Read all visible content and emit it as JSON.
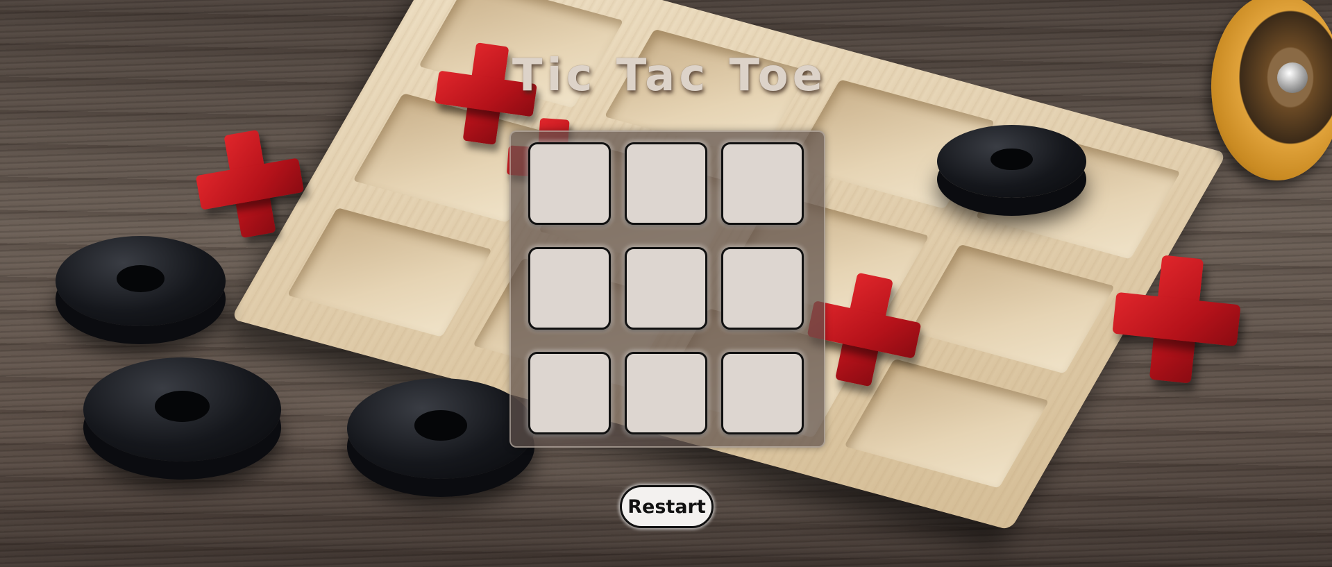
{
  "game": {
    "title": "Tic Tac Toe",
    "board": {
      "cells": [
        "",
        "",
        "",
        "",
        "",
        "",
        "",
        "",
        ""
      ]
    },
    "restart_label": "Restart"
  },
  "theme": {
    "cell_fill": "#ddd6d0",
    "cell_border": "#111111",
    "panel_fill": "rgba(95, 82, 76, 0.72)",
    "button_fill": "#f3f1ef",
    "title_color": "#ddd3c9"
  }
}
